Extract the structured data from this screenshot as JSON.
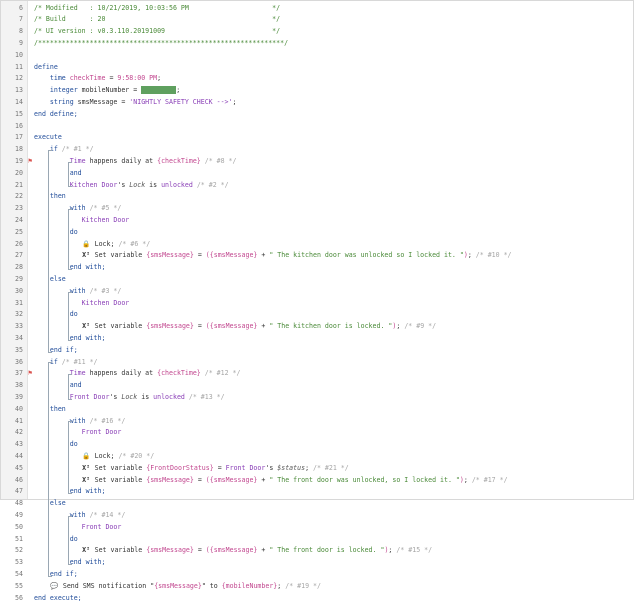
{
  "lines": [
    {
      "n": "6",
      "segs": [
        [
          "cm",
          "/* Modified   : 10/21/2019, 10:03:56 PM                     */"
        ]
      ]
    },
    {
      "n": "7",
      "segs": [
        [
          "cm",
          "/* Build      : 20                                          */"
        ]
      ]
    },
    {
      "n": "8",
      "segs": [
        [
          "cm",
          "/* UI version : v0.3.110.20191009                           */"
        ]
      ]
    },
    {
      "n": "9",
      "segs": [
        [
          "cm",
          "/**************************************************************/"
        ]
      ]
    },
    {
      "n": "10",
      "segs": []
    },
    {
      "n": "11",
      "segs": [
        [
          "kw",
          "define"
        ]
      ]
    },
    {
      "n": "12",
      "segs": [
        [
          "kw",
          "    time "
        ],
        [
          "var",
          "checkTime"
        ],
        [
          "dk",
          " = "
        ],
        [
          "var",
          "9:58:00 PM"
        ],
        [
          "dk",
          ";"
        ]
      ]
    },
    {
      "n": "13",
      "segs": [
        [
          "kw",
          "    integer "
        ],
        [
          "dk",
          "mobileNumber = "
        ],
        [
          "redact",
          ""
        ],
        [
          "dk",
          ";"
        ]
      ]
    },
    {
      "n": "14",
      "segs": [
        [
          "kw",
          "    string "
        ],
        [
          "dk",
          "smsMessage = "
        ],
        [
          "str",
          "'NIGHTLY SAFETY CHECK -->'"
        ],
        [
          "dk",
          ";"
        ]
      ]
    },
    {
      "n": "15",
      "segs": [
        [
          "kw",
          "end define;"
        ]
      ]
    },
    {
      "n": "16",
      "segs": []
    },
    {
      "n": "17",
      "segs": [
        [
          "kw",
          "execute"
        ]
      ]
    },
    {
      "n": "18",
      "segs": [
        [
          "kw",
          "    if "
        ],
        [
          "cmg",
          "/* #1 */"
        ]
      ]
    },
    {
      "n": "19",
      "mark": "⚑",
      "segs": [
        [
          "dk",
          "         "
        ],
        [
          "dev",
          "Time"
        ],
        [
          "dk",
          " happens daily at "
        ],
        [
          "var",
          "{checkTime}"
        ],
        [
          "cmg",
          " /* #8 */"
        ]
      ]
    },
    {
      "n": "20",
      "segs": [
        [
          "dk",
          "         "
        ],
        [
          "kw",
          "and"
        ]
      ]
    },
    {
      "n": "21",
      "segs": [
        [
          "dk",
          "         "
        ],
        [
          "dev",
          "Kitchen Door"
        ],
        [
          "dk",
          "'s "
        ],
        [
          "prop",
          "Lock"
        ],
        [
          "dk",
          " is "
        ],
        [
          "dev",
          "unlocked"
        ],
        [
          "cmg",
          " /* #2 */"
        ]
      ]
    },
    {
      "n": "22",
      "segs": [
        [
          "kw",
          "    then"
        ]
      ]
    },
    {
      "n": "23",
      "segs": [
        [
          "kw",
          "         with "
        ],
        [
          "cmg",
          "/* #5 */"
        ]
      ]
    },
    {
      "n": "24",
      "segs": [
        [
          "dk",
          "            "
        ],
        [
          "dev",
          "Kitchen Door"
        ]
      ]
    },
    {
      "n": "25",
      "segs": [
        [
          "kw",
          "         do"
        ]
      ]
    },
    {
      "n": "26",
      "segs": [
        [
          "dk",
          "            "
        ],
        [
          "ico",
          "🔒"
        ],
        [
          "dk",
          " Lock;"
        ],
        [
          "cmg",
          " /* #6 */"
        ]
      ]
    },
    {
      "n": "27",
      "segs": [
        [
          "dk",
          "            "
        ],
        [
          "ico",
          "Xᴵ"
        ],
        [
          "dk",
          " Set variable "
        ],
        [
          "col",
          "{smsMessage}"
        ],
        [
          "dk",
          " = "
        ],
        [
          "col",
          "({smsMessage}"
        ],
        [
          "dk",
          " + "
        ],
        [
          "cm",
          "\" The kitchen door was unlocked so I locked it. \""
        ],
        [
          "col",
          ")"
        ],
        [
          "dk",
          ";"
        ],
        [
          "cmg",
          " /* #10 */"
        ]
      ]
    },
    {
      "n": "28",
      "segs": [
        [
          "kw",
          "         end with;"
        ]
      ]
    },
    {
      "n": "29",
      "segs": [
        [
          "kw",
          "    else"
        ]
      ]
    },
    {
      "n": "30",
      "segs": [
        [
          "kw",
          "         with "
        ],
        [
          "cmg",
          "/* #3 */"
        ]
      ]
    },
    {
      "n": "31",
      "segs": [
        [
          "dk",
          "            "
        ],
        [
          "dev",
          "Kitchen Door"
        ]
      ]
    },
    {
      "n": "32",
      "segs": [
        [
          "kw",
          "         do"
        ]
      ]
    },
    {
      "n": "33",
      "segs": [
        [
          "dk",
          "            "
        ],
        [
          "ico",
          "Xᴵ"
        ],
        [
          "dk",
          " Set variable "
        ],
        [
          "col",
          "{smsMessage}"
        ],
        [
          "dk",
          " = "
        ],
        [
          "col",
          "({smsMessage}"
        ],
        [
          "dk",
          " + "
        ],
        [
          "cm",
          "\" The kitchen door is locked. \""
        ],
        [
          "col",
          ")"
        ],
        [
          "dk",
          ";"
        ],
        [
          "cmg",
          " /* #9 */"
        ]
      ]
    },
    {
      "n": "34",
      "segs": [
        [
          "kw",
          "         end with;"
        ]
      ]
    },
    {
      "n": "35",
      "segs": [
        [
          "kw",
          "    end if;"
        ]
      ]
    },
    {
      "n": "36",
      "segs": [
        [
          "kw",
          "    if "
        ],
        [
          "cmg",
          "/* #11 */"
        ]
      ]
    },
    {
      "n": "37",
      "mark": "⚑",
      "segs": [
        [
          "dk",
          "         "
        ],
        [
          "dev",
          "Time"
        ],
        [
          "dk",
          " happens daily at "
        ],
        [
          "var",
          "{checkTime}"
        ],
        [
          "cmg",
          " /* #12 */"
        ]
      ]
    },
    {
      "n": "38",
      "segs": [
        [
          "dk",
          "         "
        ],
        [
          "kw",
          "and"
        ]
      ]
    },
    {
      "n": "39",
      "segs": [
        [
          "dk",
          "         "
        ],
        [
          "dev",
          "Front Door"
        ],
        [
          "dk",
          "'s "
        ],
        [
          "prop",
          "Lock"
        ],
        [
          "dk",
          " is "
        ],
        [
          "dev",
          "unlocked"
        ],
        [
          "cmg",
          " /* #13 */"
        ]
      ]
    },
    {
      "n": "40",
      "segs": [
        [
          "kw",
          "    then"
        ]
      ]
    },
    {
      "n": "41",
      "segs": [
        [
          "kw",
          "         with "
        ],
        [
          "cmg",
          "/* #16 */"
        ]
      ]
    },
    {
      "n": "42",
      "segs": [
        [
          "dk",
          "            "
        ],
        [
          "dev",
          "Front Door"
        ]
      ]
    },
    {
      "n": "43",
      "segs": [
        [
          "kw",
          "         do"
        ]
      ]
    },
    {
      "n": "44",
      "segs": [
        [
          "dk",
          "            "
        ],
        [
          "ico",
          "🔒"
        ],
        [
          "dk",
          " Lock;"
        ],
        [
          "cmg",
          " /* #20 */"
        ]
      ]
    },
    {
      "n": "45",
      "segs": [
        [
          "dk",
          "            "
        ],
        [
          "ico",
          "Xᴵ"
        ],
        [
          "dk",
          " Set variable "
        ],
        [
          "col",
          "{FrontDoorStatus}"
        ],
        [
          "dk",
          " = "
        ],
        [
          "dev",
          "Front Door"
        ],
        [
          "dk",
          "'s "
        ],
        [
          "prop",
          "$status"
        ],
        [
          "dk",
          ";"
        ],
        [
          "cmg",
          " /* #21 */"
        ]
      ]
    },
    {
      "n": "46",
      "segs": [
        [
          "dk",
          "            "
        ],
        [
          "ico",
          "Xᴵ"
        ],
        [
          "dk",
          " Set variable "
        ],
        [
          "col",
          "{smsMessage}"
        ],
        [
          "dk",
          " = "
        ],
        [
          "col",
          "({smsMessage}"
        ],
        [
          "dk",
          " + "
        ],
        [
          "cm",
          "\" The front door was unlocked, so I locked it. \""
        ],
        [
          "col",
          ")"
        ],
        [
          "dk",
          ";"
        ],
        [
          "cmg",
          " /* #17 */"
        ]
      ]
    },
    {
      "n": "47",
      "segs": [
        [
          "kw",
          "         end with;"
        ]
      ]
    },
    {
      "n": "48",
      "segs": [
        [
          "kw",
          "    else"
        ]
      ]
    },
    {
      "n": "49",
      "segs": [
        [
          "kw",
          "         with "
        ],
        [
          "cmg",
          "/* #14 */"
        ]
      ]
    },
    {
      "n": "50",
      "segs": [
        [
          "dk",
          "            "
        ],
        [
          "dev",
          "Front Door"
        ]
      ]
    },
    {
      "n": "51",
      "segs": [
        [
          "kw",
          "         do"
        ]
      ]
    },
    {
      "n": "52",
      "segs": [
        [
          "dk",
          "            "
        ],
        [
          "ico",
          "Xᴵ"
        ],
        [
          "dk",
          " Set variable "
        ],
        [
          "col",
          "{smsMessage}"
        ],
        [
          "dk",
          " = "
        ],
        [
          "col",
          "({smsMessage}"
        ],
        [
          "dk",
          " + "
        ],
        [
          "cm",
          "\" The front door is locked. \""
        ],
        [
          "col",
          ")"
        ],
        [
          "dk",
          ";"
        ],
        [
          "cmg",
          " /* #15 */"
        ]
      ]
    },
    {
      "n": "53",
      "segs": [
        [
          "kw",
          "         end with;"
        ]
      ]
    },
    {
      "n": "54",
      "segs": [
        [
          "kw",
          "    end if;"
        ]
      ]
    },
    {
      "n": "55",
      "segs": [
        [
          "dk",
          "    "
        ],
        [
          "ico",
          "💬"
        ],
        [
          "dk",
          " Send SMS notification "
        ],
        [
          "dk",
          "\""
        ],
        [
          "col",
          "{smsMessage}"
        ],
        [
          "dk",
          "\" to "
        ],
        [
          "col",
          "{mobileNumber}"
        ],
        [
          "dk",
          ";"
        ],
        [
          "cmg",
          " /* #19 */"
        ]
      ]
    },
    {
      "n": "56",
      "segs": [
        [
          "kw",
          "end execute;"
        ]
      ]
    }
  ]
}
